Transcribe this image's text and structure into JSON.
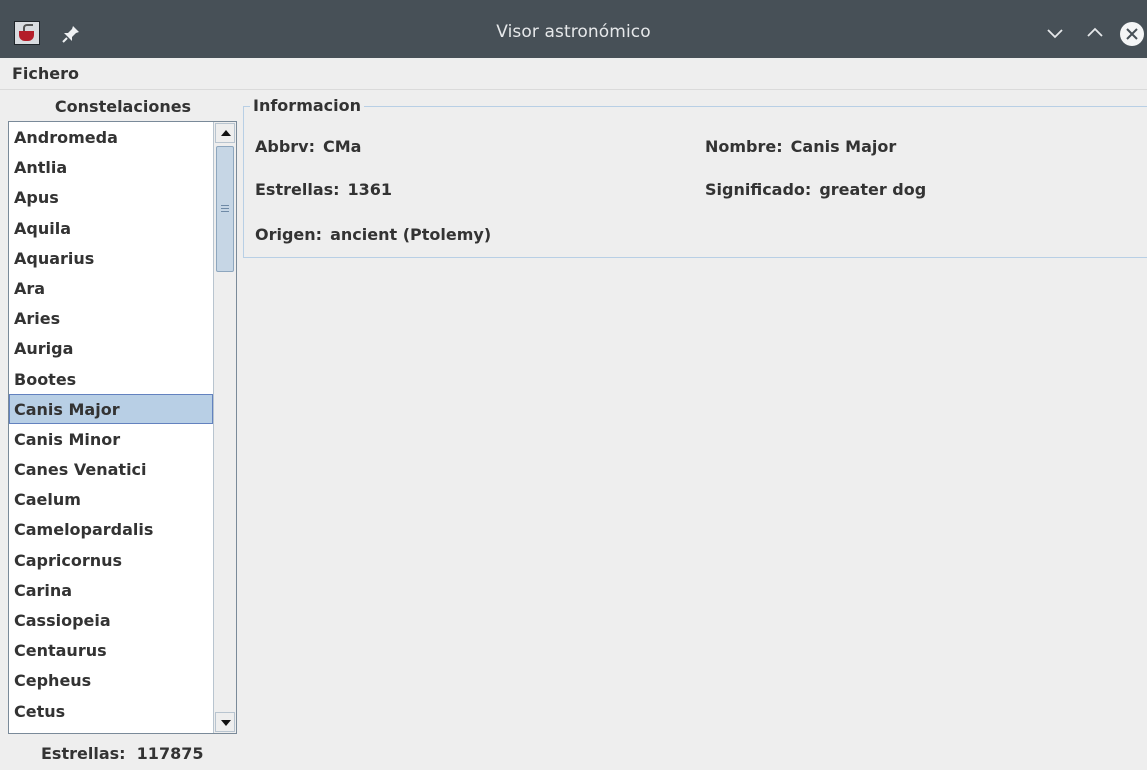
{
  "window": {
    "title": "Visor astronómico",
    "app_icon": "java-app-icon",
    "pin_icon": "pin-icon",
    "controls": [
      "minimize-icon",
      "maximize-icon",
      "close-icon"
    ]
  },
  "menubar": {
    "items": [
      {
        "label": "Fichero"
      }
    ]
  },
  "left_panel": {
    "title": "Constelaciones",
    "items": [
      "Andromeda",
      "Antlia",
      "Apus",
      "Aquila",
      "Aquarius",
      "Ara",
      "Aries",
      "Auriga",
      "Bootes",
      "Canis Major",
      "Canis Minor",
      "Canes Venatici",
      "Caelum",
      "Camelopardalis",
      "Capricornus",
      "Carina",
      "Cassiopeia",
      "Centaurus",
      "Cepheus",
      "Cetus"
    ],
    "selected": "Canis Major",
    "status": {
      "label": "Estrellas:",
      "value": "117875"
    }
  },
  "info": {
    "legend": "Informacion",
    "abbrv": {
      "label": "Abbrv:",
      "value": "CMa"
    },
    "nombre": {
      "label": "Nombre:",
      "value": "Canis Major"
    },
    "estrellas": {
      "label": "Estrellas:",
      "value": "1361"
    },
    "significado": {
      "label": "Significado:",
      "value": "greater dog"
    },
    "origen": {
      "label": "Origen:",
      "value": "ancient (Ptolemy)"
    }
  },
  "colors": {
    "titlebar": "#475057",
    "selection": "#b8cfe5",
    "selection_border": "#6382bf",
    "background": "#eeeeee"
  }
}
